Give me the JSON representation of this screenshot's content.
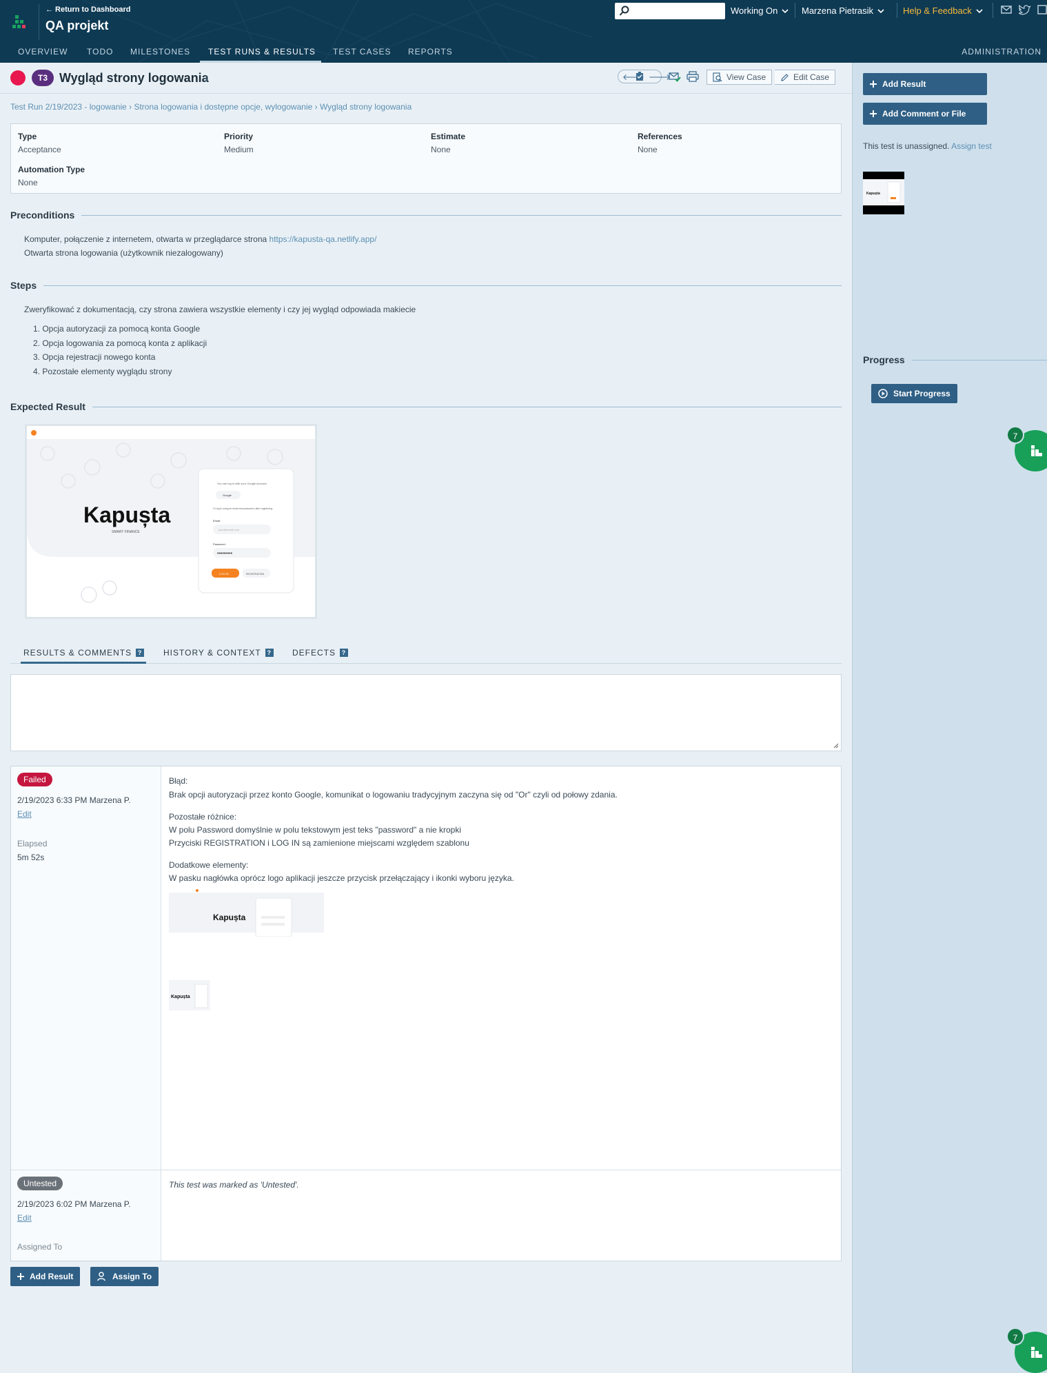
{
  "header": {
    "return_link": "← Return to Dashboard",
    "project_title": "QA projekt",
    "search_placeholder": "",
    "working_on": "Working On",
    "user_name": "Marzena Pietrasik",
    "help": "Help & Feedback",
    "help_color": "#f5b93c"
  },
  "nav": {
    "items": [
      "OVERVIEW",
      "TODO",
      "MILESTONES",
      "TEST RUNS & RESULTS",
      "TEST CASES",
      "REPORTS"
    ],
    "active": "TEST RUNS & RESULTS",
    "admin": "ADMINISTRATION"
  },
  "case": {
    "status_color": "#e8174e",
    "id_badge": "T3",
    "title": "Wygląd strony logowania",
    "view_case": "View Case",
    "edit_case": "Edit Case"
  },
  "breadcrumb": "Test Run 2/19/2023 - logowanie › Strona logowania i dostępne opcje, wylogowanie › Wygląd strony logowania",
  "properties": {
    "type_label": "Type",
    "type_value": "Acceptance",
    "priority_label": "Priority",
    "priority_value": "Medium",
    "estimate_label": "Estimate",
    "estimate_value": "None",
    "references_label": "References",
    "references_value": "None",
    "automation_label": "Automation Type",
    "automation_value": "None"
  },
  "preconditions": {
    "heading": "Preconditions",
    "line1_text": "Komputer, połączenie z internetem, otwarta w przeglądarce strona ",
    "line1_link": "https://kapusta-qa.netlify.app/",
    "line2": "Otwarta strona logowania (użytkownik niezalogowany)"
  },
  "steps": {
    "heading": "Steps",
    "intro": "Zweryfikować z dokumentacją, czy strona zawiera wszystkie elementy i czy jej wygląd odpowiada makiecie",
    "items": [
      "1. Opcja autoryzacji za pomocą konta Google",
      "2. Opcja logowania za pomocą konta z aplikacji",
      "3. Opcja rejestracji nowego konta",
      "4. Pozostałe elementy wyglądu strony"
    ]
  },
  "expected": {
    "heading": "Expected Result",
    "brand": "Kapușta",
    "brand_sub": "SMART FINANCE",
    "login_intro": "You can log in with your Google Account:",
    "google_btn": "Google",
    "alt_intro": "Or log in using an email and password, after registering:",
    "email_label": "Email:",
    "email_placeholder": "your@email.com",
    "password_label": "Password:",
    "password_value": "•••••••••",
    "login_btn": "LOG IN",
    "register_btn": "REGISTRATION"
  },
  "tabs": {
    "results": "RESULTS & COMMENTS",
    "history": "HISTORY & CONTEXT",
    "defects": "DEFECTS",
    "help_mark": "?"
  },
  "results": [
    {
      "status": "Failed",
      "datetime": "2/19/2023 6:33 PM Marzena P.",
      "edit": "Edit",
      "elapsed_label": "Elapsed",
      "elapsed_value": "5m 52s",
      "p1_l1": "Błąd:",
      "p1_l2": "Brak opcji autoryzacji przez konto Google, komunikat o logowaniu tradycyjnym zaczyna się od \"Or\" czyli od połowy zdania.",
      "p2_l1": "Pozostałe różnice:",
      "p2_l2": "W polu Password domyślnie w polu tekstowym jest teks \"password\" a nie kropki",
      "p2_l3": "Przyciski REGISTRATION i LOG IN są zamienione miejscami względem szablonu",
      "p3_l1": "Dodatkowe elementy:",
      "p3_l2": "W pasku nagłówka oprócz logo aplikacji jeszcze przycisk przełączający i ikonki wyboru języka.",
      "thumb_brand": "Kapușta"
    },
    {
      "status": "Untested",
      "datetime": "2/19/2023 6:02 PM Marzena P.",
      "edit": "Edit",
      "assigned_label": "Assigned To",
      "message": "This test was marked as 'Untested'."
    }
  ],
  "bottom_buttons": {
    "add_result": "Add Result",
    "assign_to": "Assign To"
  },
  "sidebar": {
    "add_result": "Add Result",
    "add_comment": "Add Comment or File",
    "unassigned_text": "This test is unassigned. ",
    "assign_link": "Assign test",
    "thumb_brand": "Kapușta",
    "progress_heading": "Progress",
    "start_progress": "Start Progress"
  },
  "widget": {
    "count": "7",
    "color": "#18a058"
  }
}
